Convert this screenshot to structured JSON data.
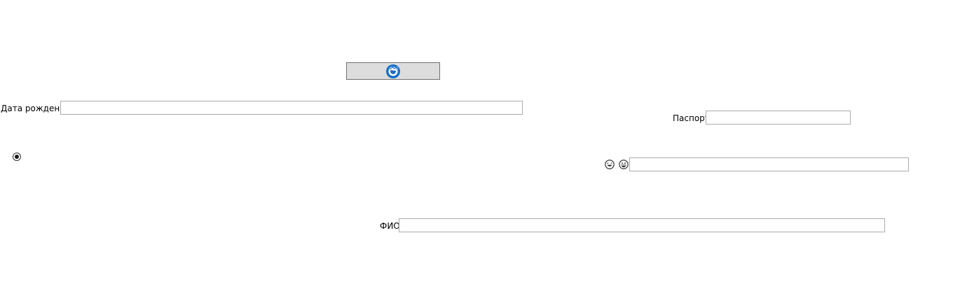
{
  "form": {
    "button_icon": "chrome-like-icon",
    "birthdate_label": "Дата рождения",
    "birthdate_value": "",
    "passport_label": "Паспорт",
    "passport_value": "",
    "radio_selected": true,
    "emoji_left": "laughing-face-icon",
    "emoji_right": "grinning-face-icon",
    "emoji_field_value": "",
    "fio_label": "ФИО",
    "fio_value": ""
  },
  "colors": {
    "button_icon": "#1a6fc4",
    "button_face": "#dddddd",
    "field_border": "#ababab"
  }
}
